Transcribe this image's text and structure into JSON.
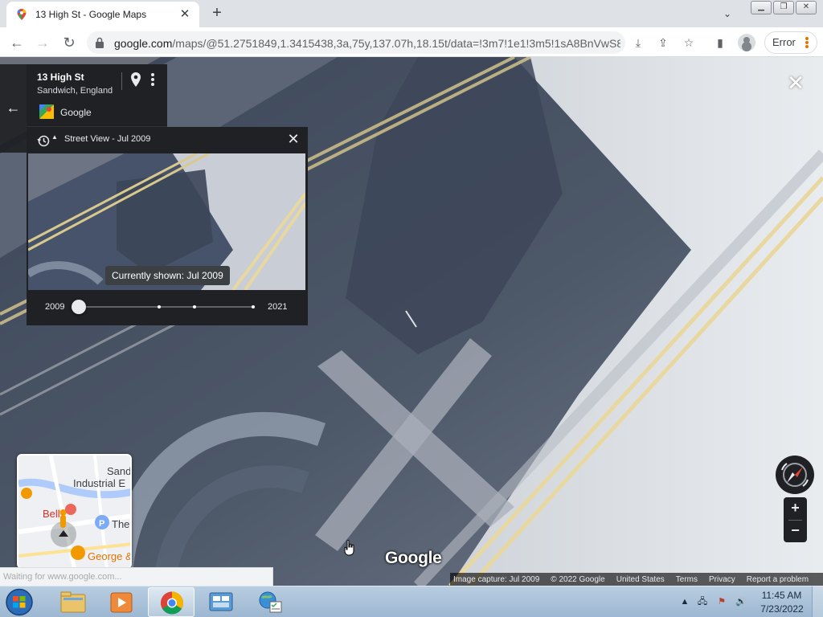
{
  "browser": {
    "tab_title": "13 High St - Google Maps",
    "tab_close": "✕",
    "new_tab": "+",
    "tab_search": "⌄",
    "url_host": "google.com",
    "url_rest": "/maps/@51.2751849,1.3415438,3a,75y,137.07h,18.15t/data=!3m7!1e1!3m5!1sA8BnVwS8...",
    "error_label": "Error"
  },
  "place": {
    "title": "13 High St",
    "subtitle": "Sandwich, England",
    "source": "Google"
  },
  "timemachine": {
    "title": "Street View - Jul 2009",
    "tooltip": "Currently shown: Jul 2009",
    "year_start": "2009",
    "year_end": "2021",
    "close": "✕"
  },
  "controls": {
    "zoom_in": "+",
    "zoom_out": "−",
    "close_streetview": "✕"
  },
  "minimap": {
    "labels": [
      "Sand",
      "Industrial E",
      "Bell",
      "The",
      "George &"
    ]
  },
  "watermark": "Google",
  "footer": {
    "capture": "Image capture: Jul 2009",
    "copyright": "© 2022 Google",
    "region": "United States",
    "terms": "Terms",
    "privacy": "Privacy",
    "report": "Report a problem"
  },
  "status_text": "Waiting for www.google.com...",
  "taskbar": {
    "time": "11:45 AM",
    "date": "7/23/2022"
  },
  "colors": {
    "maps_dark": "#202124",
    "road": "#4a5566",
    "lane_yellow": "#e8d8a0"
  }
}
